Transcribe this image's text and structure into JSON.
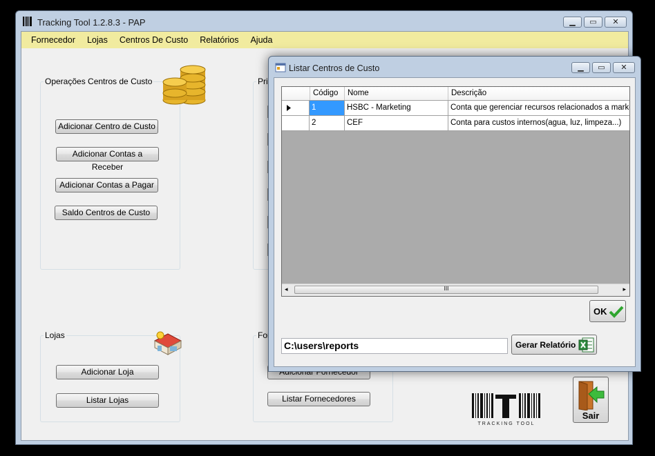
{
  "window": {
    "title": "Tracking Tool 1.2.8.3 - PAP"
  },
  "menu": [
    "Fornecedor",
    "Lojas",
    "Centros De Custo",
    "Relatórios",
    "Ajuda"
  ],
  "groups": {
    "centros": {
      "title": "Operações Centros de Custo",
      "buttons": [
        "Adicionar Centro de Custo",
        "Adicionar Contas a Receber",
        "Adicionar Contas a Pagar",
        "Saldo Centros de Custo"
      ]
    },
    "principal": {
      "title": "Prin"
    },
    "lojas": {
      "title": "Lojas",
      "buttons": [
        "Adicionar Loja",
        "Listar Lojas"
      ]
    },
    "fornecedores": {
      "title": "For",
      "buttons": [
        "Adicionar Fornecedor",
        "Listar Fornecedores"
      ]
    }
  },
  "exit_button": "Sair",
  "logo_text": "TRACKING TOOL",
  "dialog": {
    "title": "Listar Centros de Custo",
    "columns": [
      "Código",
      "Nome",
      "Descrição"
    ],
    "rows": [
      [
        "1",
        "HSBC - Marketing",
        "Conta que gerenciar recursos relacionados a marketing"
      ],
      [
        "2",
        "CEF",
        "Conta para custos internos(agua, luz, limpeza...)"
      ]
    ],
    "scroll_grip": "III",
    "ok_label": "OK",
    "path_value": "C:\\users\\reports",
    "report_button": "Gerar Relatório"
  },
  "colors": {
    "menubar": "#f1eb9f",
    "selection": "#3399ff",
    "grid_empty": "#ababab"
  }
}
